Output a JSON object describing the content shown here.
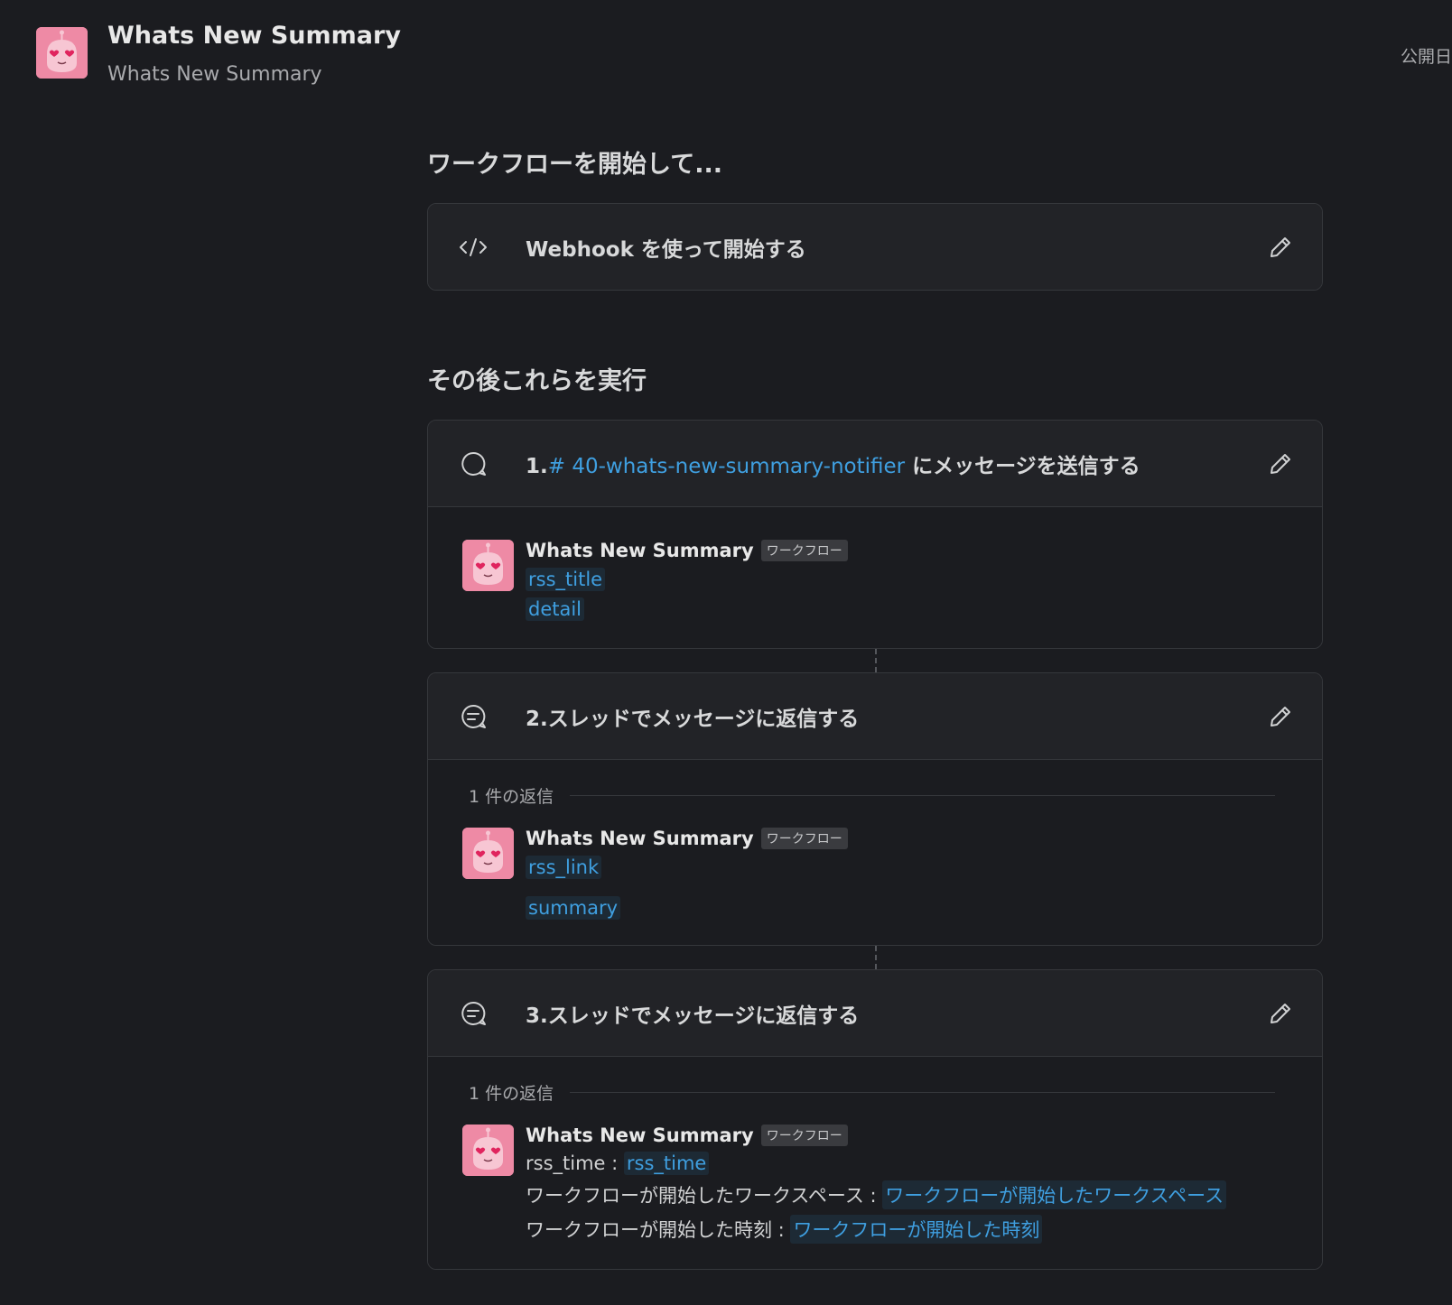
{
  "app": {
    "title": "Whats New Summary",
    "subtitle": "Whats New Summary",
    "published_label": "公開日"
  },
  "trigger_section": {
    "heading": "ワークフローを開始して...",
    "step": {
      "icon": "code-icon",
      "title": "Webhook を使って開始する"
    }
  },
  "steps_section": {
    "heading": "その後これらを実行"
  },
  "steps": [
    {
      "number": "1.",
      "channel": "# 40-whats-new-summary-notifier",
      "title_suffix": " にメッセージを送信する",
      "icon": "message-bubble-icon",
      "message": {
        "sender": "Whats New Summary",
        "badge": "ワークフロー",
        "vars": [
          "rss_title",
          "detail"
        ]
      }
    },
    {
      "title": "2.スレッドでメッセージに返信する",
      "icon": "thread-icon",
      "reply_count": "1 件の返信",
      "message": {
        "sender": "Whats New Summary",
        "badge": "ワークフロー",
        "vars": [
          "rss_link",
          "summary"
        ]
      }
    },
    {
      "title": "3.スレッドでメッセージに返信する",
      "icon": "thread-icon",
      "reply_count": "1 件の返信",
      "message": {
        "sender": "Whats New Summary",
        "badge": "ワークフロー",
        "lines": [
          {
            "label": "rss_time : ",
            "var": "rss_time"
          },
          {
            "label": "ワークフローが開始したワークスペース : ",
            "var": "ワークフローが開始したワークスペース"
          },
          {
            "label": "ワークフローが開始した時刻 : ",
            "var": "ワークフローが開始した時刻"
          }
        ]
      }
    }
  ],
  "colors": {
    "background": "#1b1c20",
    "card": "#222327",
    "link": "#3f9fe0",
    "avatar": "#ee8aa5"
  }
}
